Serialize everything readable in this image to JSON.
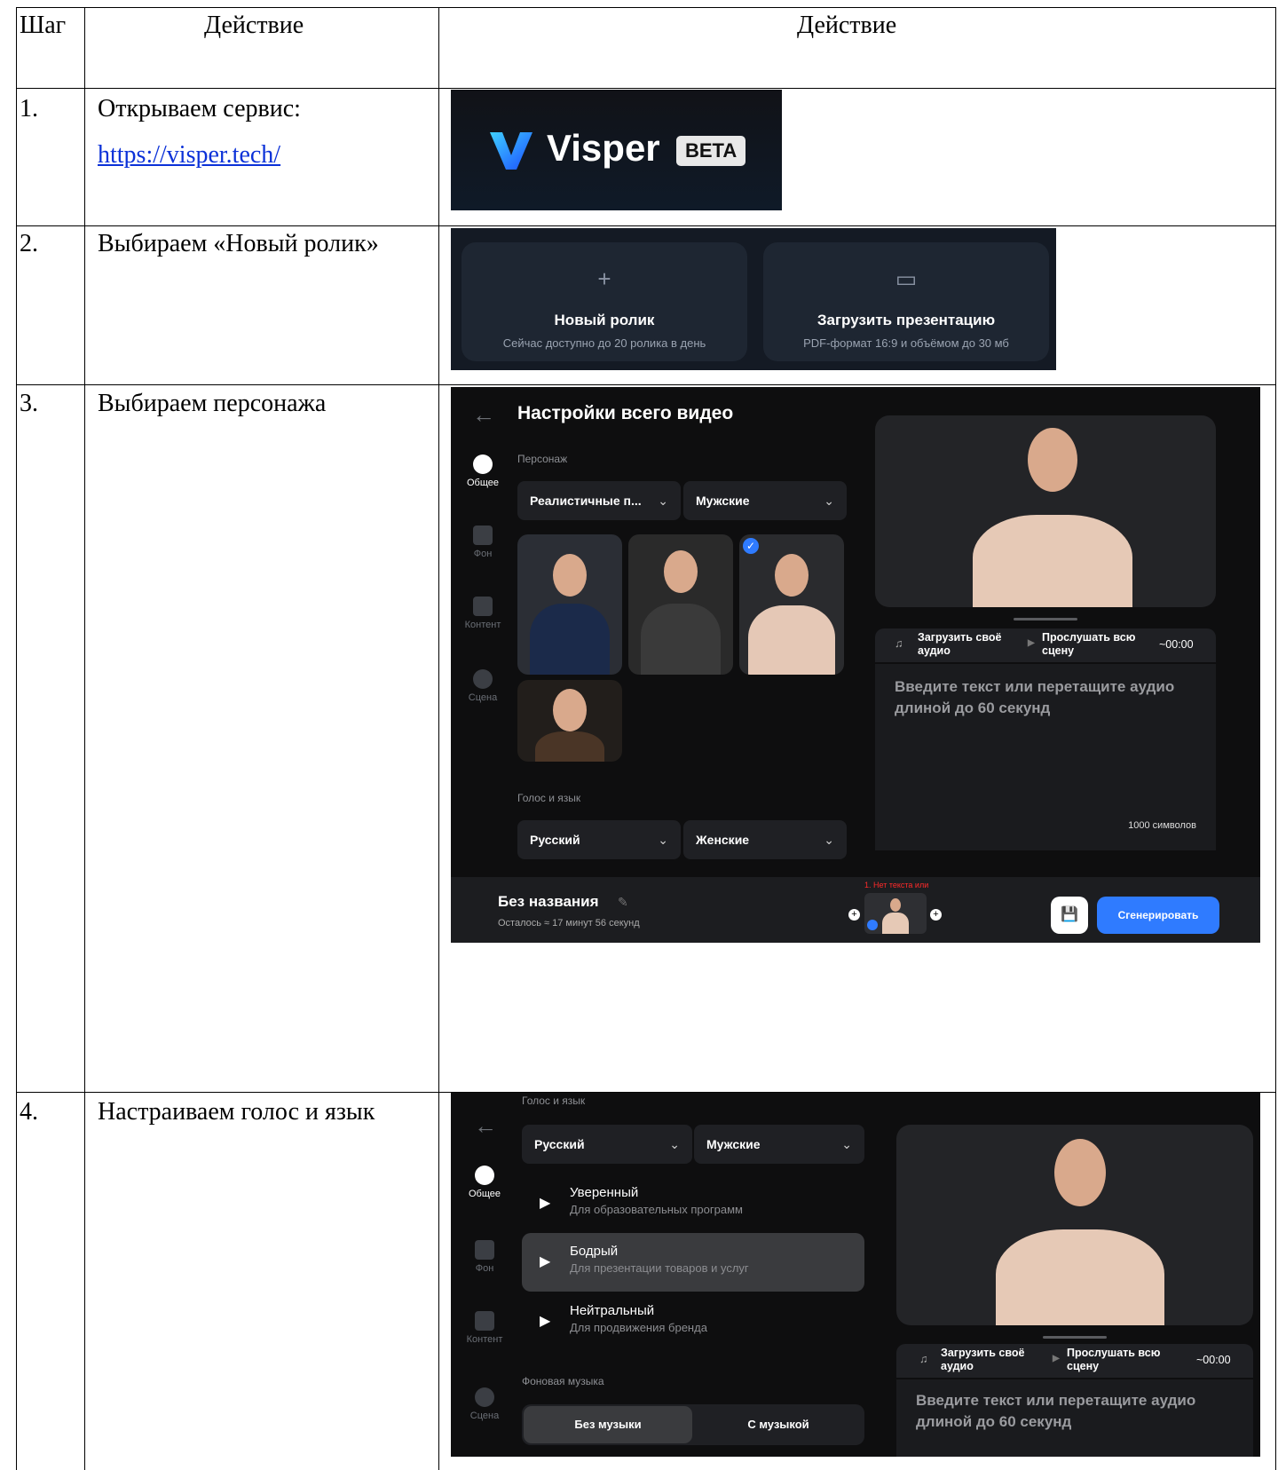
{
  "table": {
    "headers": [
      "Шаг",
      "Действие",
      "Действие"
    ],
    "rows": [
      {
        "step": "1.",
        "action": "Открываем сервис:",
        "link": "https://visper.tech/"
      },
      {
        "step": "2.",
        "action": "Выбираем «Новый ролик»"
      },
      {
        "step": "3.",
        "action": "Выбираем персонажа"
      },
      {
        "step": "4.",
        "action": "Настраиваем голос и язык"
      }
    ]
  },
  "shot1": {
    "brand": "Visper",
    "badge": "BETA"
  },
  "shot2": {
    "cards": [
      {
        "icon": "plus-icon",
        "title": "Новый ролик",
        "subtitle": "Сейчас доступно до 20 ролика в день"
      },
      {
        "icon": "monitor-icon",
        "title": "Загрузить презентацию",
        "subtitle": "PDF-формат 16:9 и объёмом до 30 мб"
      }
    ]
  },
  "shot3": {
    "title": "Настройки всего видео",
    "sidebar": [
      "Общее",
      "Фон",
      "Контент",
      "Сцена"
    ],
    "character_label": "Персонаж",
    "character_type": "Реалистичные п...",
    "character_gender": "Мужские",
    "voice_label": "Голос и язык",
    "voice_language": "Русский",
    "voice_gender": "Женские",
    "upload_audio": "Загрузить своё аудио",
    "listen_scene": "Прослушать всю сцену",
    "duration": "~00:00",
    "text_placeholder": "Введите текст или перетащите аудио длиной до 60 секунд",
    "char_limit": "1000 символов",
    "project_name": "Без названия",
    "remaining": "Осталось ≈ 17 минут 56 секунд",
    "scene_warning": "1. Нет текста или",
    "generate_button": "Сгенерировать"
  },
  "shot4": {
    "voice_label": "Голос и язык",
    "voice_language": "Русский",
    "voice_gender": "Мужские",
    "sidebar": [
      "Общее",
      "Фон",
      "Контент",
      "Сцена"
    ],
    "voices": [
      {
        "name": "Уверенный",
        "desc": "Для образовательных программ"
      },
      {
        "name": "Бодрый",
        "desc": "Для презентации товаров и услуг"
      },
      {
        "name": "Нейтральный",
        "desc": "Для продвижения бренда"
      }
    ],
    "music_label": "Фоновая музыка",
    "music_options": [
      "Без музыки",
      "С музыкой"
    ],
    "upload_audio": "Загрузить своё аудио",
    "listen_scene": "Прослушать всю сцену",
    "duration": "~00:00",
    "text_placeholder": "Введите текст или перетащите аудио длиной до 60 секунд"
  }
}
